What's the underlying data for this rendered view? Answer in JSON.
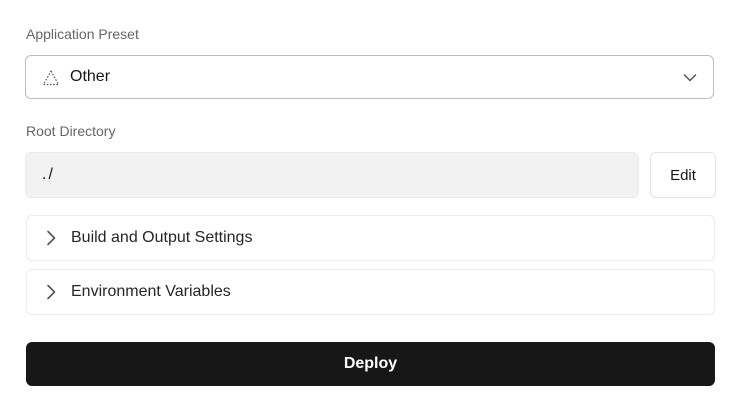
{
  "application_preset": {
    "label": "Application Preset",
    "selected_value": "Other",
    "icon": "triangle-dotted-icon"
  },
  "root_directory": {
    "label": "Root Directory",
    "value": "./",
    "edit_label": "Edit"
  },
  "sections": [
    {
      "label": "Build and Output Settings",
      "icon": "chevron-right-icon"
    },
    {
      "label": "Environment Variables",
      "icon": "chevron-right-icon"
    }
  ],
  "deploy": {
    "label": "Deploy",
    "background_color": "#171717",
    "text_color": "#ffffff"
  }
}
